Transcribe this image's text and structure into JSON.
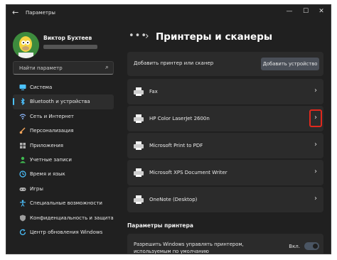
{
  "window": {
    "back_icon": "back-arrow-icon",
    "title": "Параметры",
    "controls": [
      "minimize-icon",
      "maximize-icon",
      "close-icon"
    ]
  },
  "user": {
    "name": "Виктор Бухтеев",
    "avatar": "avatar-character-image"
  },
  "search": {
    "placeholder": "Найти параметр",
    "icon": "search-icon"
  },
  "sidebar": {
    "items": [
      {
        "label": "Система",
        "icon": "monitor-icon",
        "color": "#4cc2ff",
        "active": false
      },
      {
        "label": "Bluetooth и устройства",
        "icon": "bluetooth-icon",
        "color": "#4cc2ff",
        "active": true
      },
      {
        "label": "Сеть и Интернет",
        "icon": "network-icon",
        "color": "#8ab4f8",
        "active": false
      },
      {
        "label": "Персонализация",
        "icon": "brush-icon",
        "color": "#f0a35a",
        "active": false
      },
      {
        "label": "Приложения",
        "icon": "apps-icon",
        "color": "#b0b0b0",
        "active": false
      },
      {
        "label": "Учетные записи",
        "icon": "person-icon",
        "color": "#3fb950",
        "active": false
      },
      {
        "label": "Время и язык",
        "icon": "clock-globe-icon",
        "color": "#4cc2ff",
        "active": false
      },
      {
        "label": "Игры",
        "icon": "gamepad-icon",
        "color": "#b0b0b0",
        "active": false
      },
      {
        "label": "Специальные возможности",
        "icon": "accessibility-icon",
        "color": "#4cc2ff",
        "active": false
      },
      {
        "label": "Конфиденциальность и защита",
        "icon": "shield-icon",
        "color": "#9e9e9e",
        "active": false
      },
      {
        "label": "Центр обновления Windows",
        "icon": "refresh-icon",
        "color": "#4cc2ff",
        "active": false
      }
    ]
  },
  "main": {
    "breadcrumb_dots": "•••",
    "breadcrumb_sep": "›",
    "title": "Принтеры и сканеры",
    "add_printer": {
      "label": "Добавить принтер или сканер",
      "button": "Добавить устройство"
    },
    "printers": [
      {
        "name": "Fax",
        "highlighted": false
      },
      {
        "name": "HP Color LaserJet 2600n",
        "highlighted": true
      },
      {
        "name": "Microsoft Print to PDF",
        "highlighted": false
      },
      {
        "name": "Microsoft XPS Document Writer",
        "highlighted": false
      },
      {
        "name": "OneNote (Desktop)",
        "highlighted": false
      }
    ],
    "printer_prefs": {
      "header": "Параметры принтера",
      "manage_default_line1": "Разрешить Windows управлять принтером,",
      "manage_default_line2": "используемым по умолчанию",
      "toggle_label": "Вкл.",
      "toggle_on": true
    }
  },
  "colors": {
    "accent": "#4cc2ff",
    "highlight_box": "#e0281d",
    "background": "#202020",
    "card": "#2b2b2b"
  }
}
